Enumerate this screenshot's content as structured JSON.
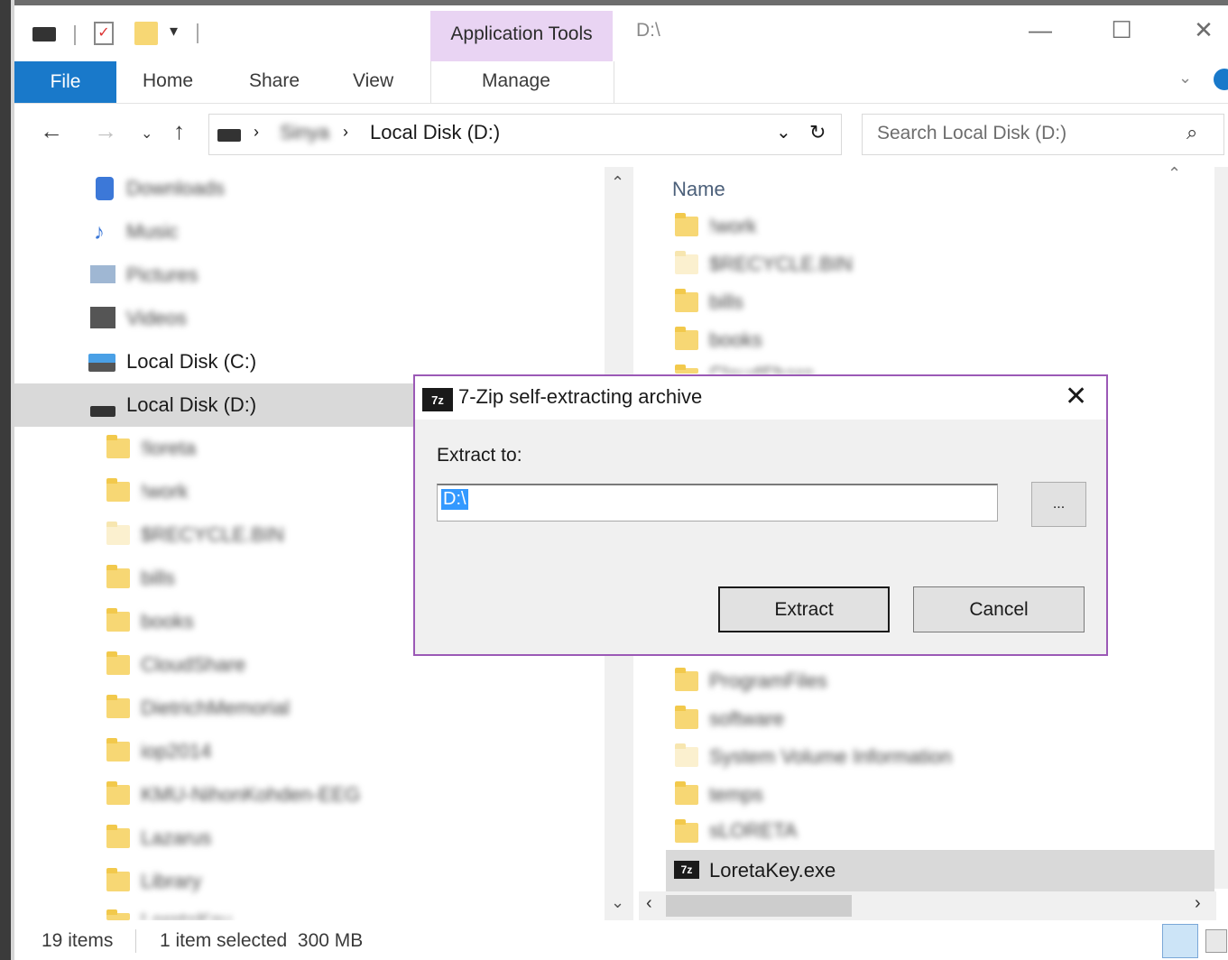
{
  "title_bar": {
    "context_tab_group": "Application Tools",
    "path": "D:\\",
    "minimize_glyph": "—",
    "maximize_glyph": "☐",
    "close_glyph": "✕"
  },
  "ribbon": {
    "tabs": [
      "File",
      "Home",
      "Share",
      "View",
      "Manage"
    ]
  },
  "address_bar": {
    "crumb_parent": "Sinya",
    "crumb_current": "Local Disk (D:)",
    "search_placeholder": "Search Local Disk (D:)"
  },
  "nav_pane": {
    "quick_items": [
      "Downloads",
      "Music",
      "Pictures",
      "Videos"
    ],
    "drives": [
      "Local Disk (C:)",
      "Local Disk (D:)"
    ],
    "folders": [
      "!loreta",
      "!work",
      "$RECYCLE.BIN",
      "bills",
      "books",
      "CloudShare",
      "DietrichMemorial",
      "iop2014",
      "KMU-NihonKohden-EEG",
      "Lazarus",
      "Library",
      "LoretaKey"
    ]
  },
  "content": {
    "column_header": "Name",
    "top_items": [
      "!work",
      "$RECYCLE.BIN",
      "bills",
      "books",
      "CloudShare"
    ],
    "bottom_items": [
      "ProgramFiles",
      "software",
      "System Volume Information",
      "temps",
      "sLORETA"
    ],
    "selected_file": "LoretaKey.exe",
    "file_icon_label": "7z"
  },
  "status_bar": {
    "item_count": "19 items",
    "selection": "1 item selected  300 MB"
  },
  "dialog": {
    "icon_label": "7z",
    "title": "7-Zip self-extracting archive",
    "extract_label": "Extract to:",
    "path_value": "D:\\",
    "browse_label": "...",
    "extract_button": "Extract",
    "cancel_button": "Cancel"
  },
  "colors": {
    "file_tab": "#1979ca",
    "context_tab": "#e9d4f3",
    "dialog_border": "#9b59b6",
    "selection": "#d9d9d9",
    "text_selection": "#3399ff",
    "folder": "#f7d774"
  }
}
